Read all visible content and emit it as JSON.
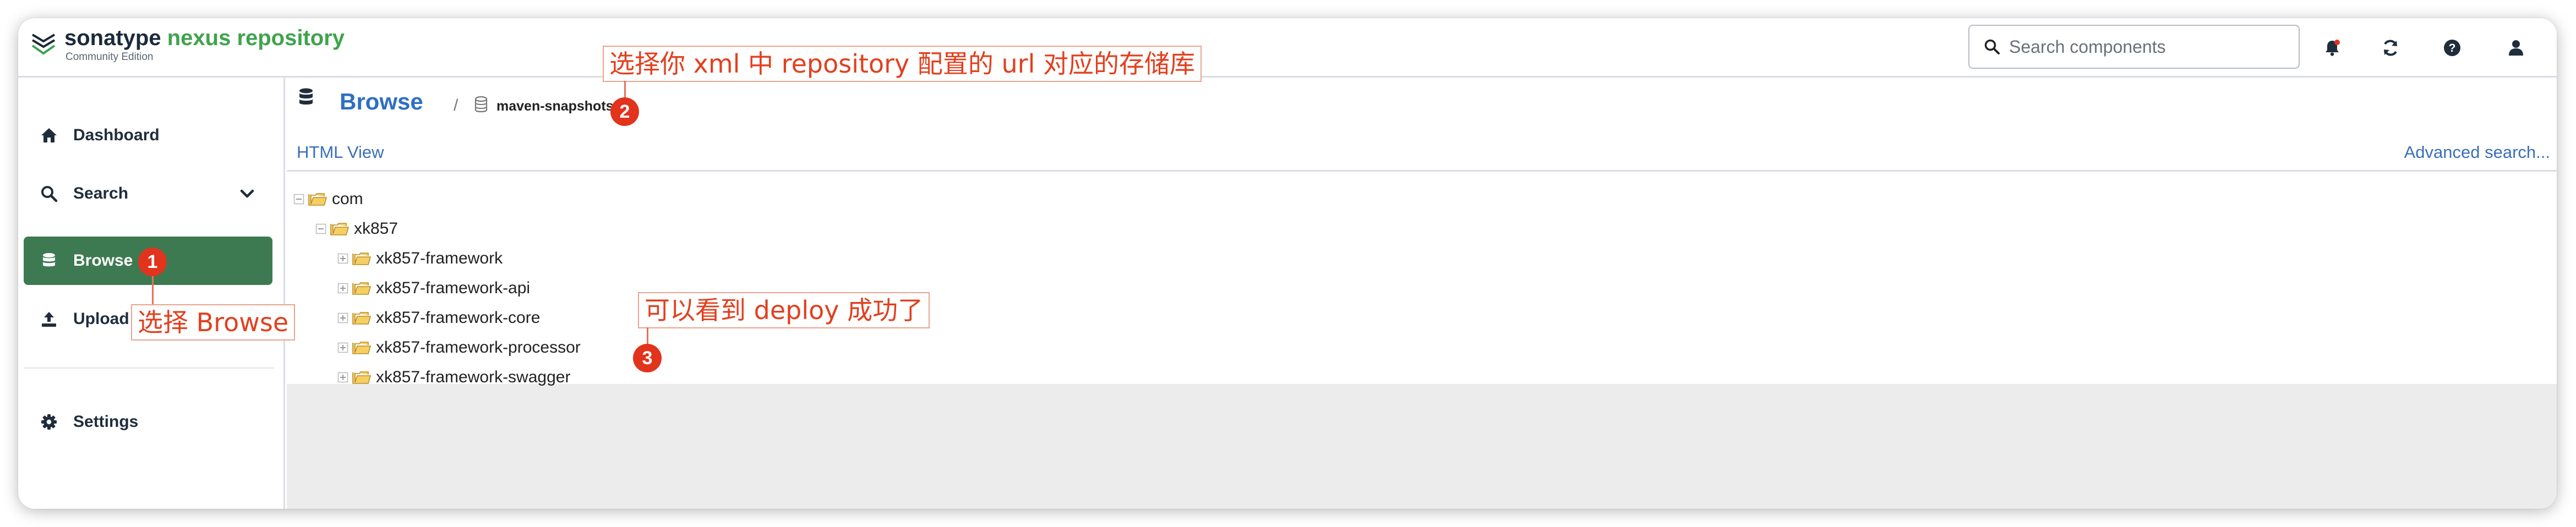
{
  "header": {
    "brand_part1": "sonatype ",
    "brand_part2": "nexus repository",
    "edition": "Community Edition",
    "search_placeholder": "Search components",
    "icons": [
      "bell-icon",
      "refresh-icon",
      "help-icon",
      "user-icon"
    ]
  },
  "sidebar": {
    "items": [
      {
        "label": "Dashboard",
        "icon": "home-icon"
      },
      {
        "label": "Search",
        "icon": "search-icon"
      },
      {
        "label": "Browse",
        "icon": "database-icon",
        "active": true
      },
      {
        "label": "Upload",
        "icon": "upload-icon"
      },
      {
        "label": "Settings",
        "icon": "gear-icon"
      }
    ]
  },
  "main": {
    "breadcrumb_title": "Browse",
    "breadcrumb_separator": "/",
    "repository": "maven-snapshots",
    "html_view": "HTML View",
    "advanced_search": "Advanced search...",
    "tree": [
      {
        "label": "com",
        "level": 0
      },
      {
        "label": "xk857",
        "level": 1
      },
      {
        "label": "xk857-framework",
        "level": 2
      },
      {
        "label": "xk857-framework-api",
        "level": 2
      },
      {
        "label": "xk857-framework-core",
        "level": 2
      },
      {
        "label": "xk857-framework-processor",
        "level": 2
      },
      {
        "label": "xk857-framework-swagger",
        "level": 2
      }
    ]
  },
  "annotations": [
    {
      "number": "1",
      "text": "选择 Browse"
    },
    {
      "number": "2",
      "text": "选择你 xml 中 repository 配置的 url 对应的存储库"
    },
    {
      "number": "3",
      "text": "可以看到 deploy 成功了"
    }
  ],
  "colors": {
    "accent_green": "#3d7a52",
    "brand_green": "#3fa34d",
    "link_blue": "#3a6fb8",
    "annotation_red": "#e2331c"
  }
}
